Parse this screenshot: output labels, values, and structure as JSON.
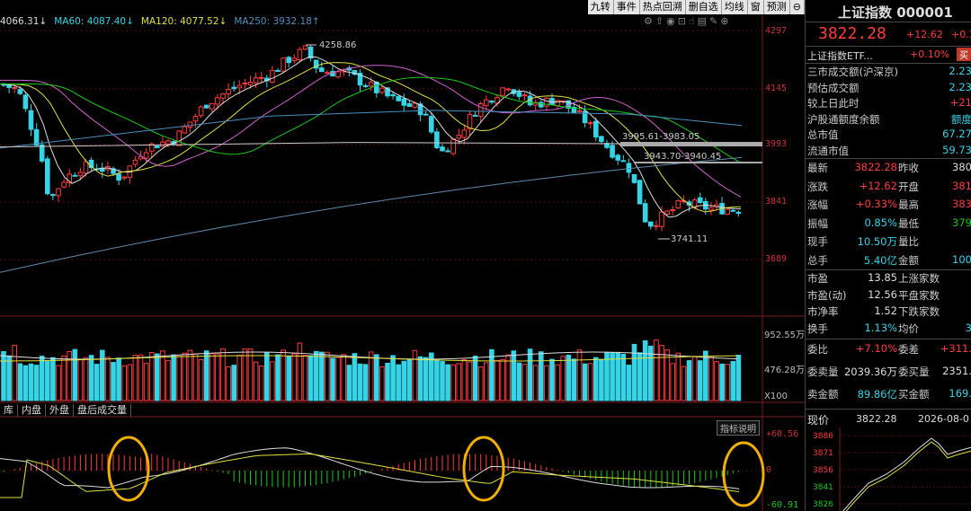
{
  "toolbar": {
    "items": [
      "九转",
      "事件",
      "热点回溯",
      "删自选",
      "均线",
      "窗",
      "预测"
    ]
  },
  "icon_bar": [
    "settings-icon",
    "up-icon",
    "eye-icon",
    "lock-icon",
    "hand-icon",
    "chart-icon",
    "edit-icon",
    "zoom-icon"
  ],
  "ma_legend": [
    {
      "text": "4066.31↓",
      "color": "#dddddd"
    },
    {
      "text": "MA60: 4087.40↓",
      "color": "#35d4e6"
    },
    {
      "text": "MA120: 4077.52↓",
      "color": "#e0e040"
    },
    {
      "text": "MA250: 3932.18↑",
      "color": "#4a8fbf"
    }
  ],
  "annotations": {
    "high": "4258.86",
    "low": "3741.11",
    "range1": "3995.61-3983.05",
    "range2": "3943.70-3940.45"
  },
  "price_axis": [
    "4297",
    "4145",
    "3993",
    "3841",
    "3689"
  ],
  "volume_axis": [
    "952.55万",
    "476.28万",
    "X100"
  ],
  "macd_axis": [
    "+60.56",
    "0",
    "-60.91"
  ],
  "bottom_tabs": [
    "库",
    "内盘",
    "外盘",
    "盘后成交量"
  ],
  "explain_button": "指标说明",
  "colors": {
    "up": "#ff3b3b",
    "down": "#35d4e6",
    "ring": "#f0b000"
  },
  "panel": {
    "title": "上证指数 000001",
    "price": "3822.28",
    "change": "+12.62",
    "change_pct_cut": "+0.3",
    "etf_name": "上证指数ETF...",
    "etf_pct": "+0.10%",
    "etf_btn": "买",
    "stats": [
      {
        "k": "三市成交额(沪深京)",
        "v": "2.23",
        "c": "cyan"
      },
      {
        "k": "预估成交额",
        "v": "2.23",
        "c": "cyan"
      },
      {
        "k": "较上日此时",
        "v": "+21",
        "c": "red"
      },
      {
        "k": "沪股通额度余额",
        "v": "额度",
        "c": "cyan"
      },
      {
        "k": "总市值",
        "v": "67.27",
        "c": "cyan"
      },
      {
        "k": "流通市值",
        "v": "59.73",
        "c": "cyan"
      }
    ],
    "quote": [
      {
        "k1": "最新",
        "v1": "3822.28",
        "c1": "red",
        "k2": "昨收",
        "v2": "380",
        "c2": "white"
      },
      {
        "k1": "涨跌",
        "v1": "+12.62",
        "c1": "red",
        "k2": "开盘",
        "v2": "381",
        "c2": "red"
      },
      {
        "k1": "涨幅",
        "v1": "+0.33%",
        "c1": "red",
        "k2": "最高",
        "v2": "383",
        "c2": "red"
      },
      {
        "k1": "振幅",
        "v1": "0.85%",
        "c1": "cyan",
        "k2": "最低",
        "v2": "379",
        "c2": "green"
      },
      {
        "k1": "现手",
        "v1": "10.50万",
        "c1": "cyan",
        "k2": "量比",
        "v2": "",
        "c2": "white"
      },
      {
        "k1": "总手",
        "v1": "5.40亿",
        "c1": "cyan",
        "k2": "金额",
        "v2": "100",
        "c2": "cyan"
      }
    ],
    "market": [
      {
        "k1": "市盈",
        "v1": "13.85",
        "c1": "white",
        "k2": "上涨家数",
        "v2": "",
        "c2": "red"
      },
      {
        "k1": "市盈(动)",
        "v1": "12.56",
        "c1": "white",
        "k2": "平盘家数",
        "v2": "",
        "c2": "white"
      },
      {
        "k1": "市净率",
        "v1": "1.52",
        "c1": "white",
        "k2": "下跌家数",
        "v2": "",
        "c2": "green"
      },
      {
        "k1": "换手",
        "v1": "1.13%",
        "c1": "cyan",
        "k2": "均价",
        "v2": "3",
        "c2": "cyan"
      }
    ],
    "orders": [
      {
        "k1": "委比",
        "v1": "+7.10%",
        "c1": "red",
        "k2": "委差",
        "v2": "+311.",
        "c2": "red"
      },
      {
        "k1": "委卖量",
        "v1": "2039.36万",
        "c1": "white",
        "k2": "委买量",
        "v2": "2351.",
        "c2": "white"
      },
      {
        "k1": "卖金额",
        "v1": "89.86亿",
        "c1": "cyan",
        "k2": "买金额",
        "v2": "169.",
        "c2": "cyan"
      }
    ],
    "mini": {
      "label": "现价",
      "price": "3822.28",
      "date": "2026-08-0",
      "ticks": [
        "3886",
        "3871",
        "3856",
        "3841",
        "3826"
      ]
    }
  }
}
